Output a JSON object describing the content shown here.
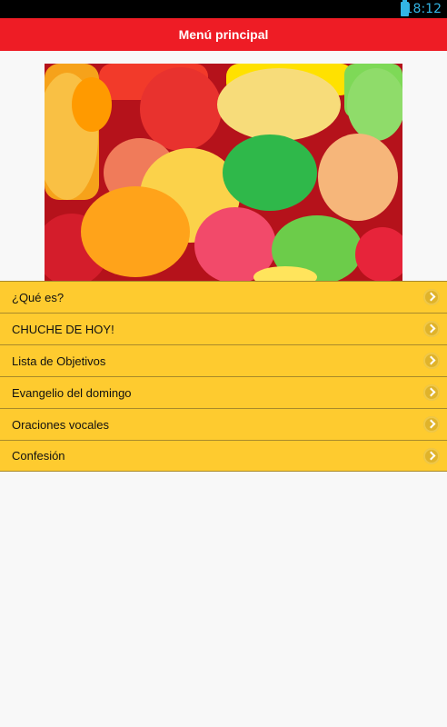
{
  "status_bar": {
    "time": "18:12",
    "battery_icon": "battery-icon"
  },
  "action_bar": {
    "title": "Menú principal",
    "color": "#ee1c25"
  },
  "hero": {
    "icon": "gummy-candies-image"
  },
  "menu": {
    "color": "#fecb2f",
    "items": [
      {
        "label": "¿Qué es?"
      },
      {
        "label": "CHUCHE DE HOY!"
      },
      {
        "label": "Lista de Objetivos"
      },
      {
        "label": "Evangelio del domingo"
      },
      {
        "label": "Oraciones vocales"
      },
      {
        "label": "Confesión"
      }
    ]
  }
}
